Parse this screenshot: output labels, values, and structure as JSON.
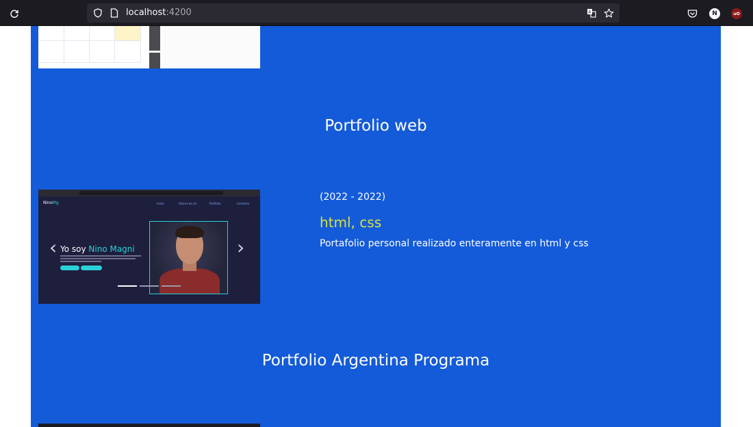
{
  "browser": {
    "url_host": "localhost",
    "url_port": ":4200",
    "profile_initial": "N",
    "ublock_label": "uO"
  },
  "portfolio_web": {
    "title": "Portfolio web",
    "screenshot": {
      "logo_prefix": "Nino",
      "logo_suffix": "Mg",
      "nav_items": [
        "Inicio",
        "Acerca de mi",
        "Portfolio",
        "Contacto"
      ],
      "headline_prefix": "Yo soy ",
      "headline_name": "Nino Magni"
    },
    "year": "(2022 - 2022)",
    "tech": "html, css",
    "description": "Portafolio personal realizado enteramente en html y css"
  },
  "portfolio_ap": {
    "title": "Portfolio Argentina Programa"
  },
  "colors": {
    "page_blue": "#145bd9",
    "tech_yellow": "#d7e23a",
    "accent_cyan": "#2ad1d8"
  }
}
